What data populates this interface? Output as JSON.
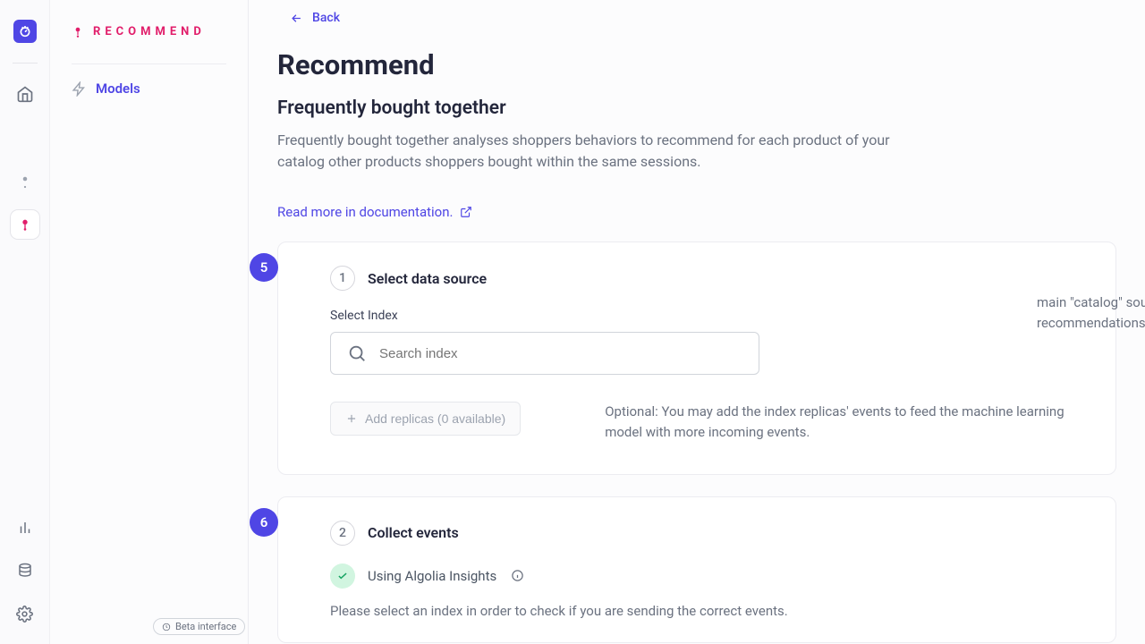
{
  "rail": {
    "bottom_icons": [
      "analytics-icon",
      "database-icon",
      "settings-icon"
    ]
  },
  "sidebar": {
    "brand": "RECOMMEND",
    "nav": {
      "models": "Models"
    },
    "beta": "Beta interface"
  },
  "back": "Back",
  "title": "Recommend",
  "subtitle": "Frequently bought together",
  "description": "Frequently bought together analyses shoppers behaviors to recommend for each product of your catalog other products shoppers bought within the same sessions.",
  "doc_link": "Read more in documentation.",
  "step1": {
    "badge": "5",
    "num": "1",
    "title": "Select data source",
    "field_label": "Select Index",
    "search_placeholder": "Search index",
    "catalog_hint": "main \"catalog\" source, from which recommendations",
    "replica_btn": "Add replicas (0 available)",
    "replica_desc": "Optional: You may add the index replicas' events to feed the machine learning model with more incoming events."
  },
  "step2": {
    "badge": "6",
    "num": "2",
    "title": "Collect events",
    "insights": "Using Algolia Insights",
    "note": "Please select an index in order to check if you are sending the correct events."
  }
}
